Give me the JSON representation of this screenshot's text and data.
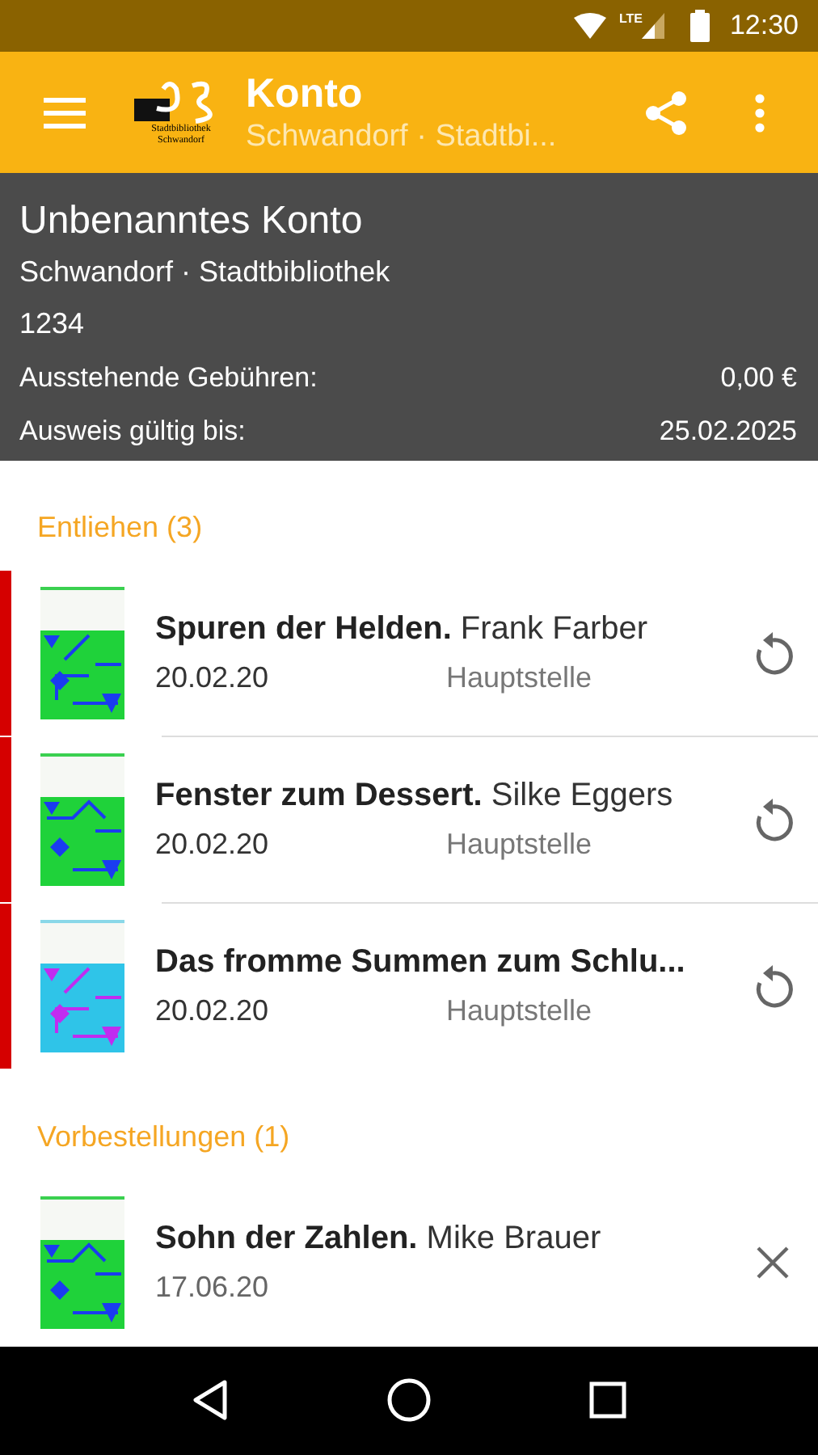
{
  "status_bar": {
    "network": "LTE",
    "time": "12:30"
  },
  "toolbar": {
    "logo_lines": [
      "Stadtbibliothek",
      "Schwandorf"
    ],
    "title": "Konto",
    "subtitle": "Schwandorf · Stadtbi..."
  },
  "account": {
    "name": "Unbenanntes Konto",
    "library": "Schwandorf · Stadtbibliothek",
    "number": "1234",
    "rows": [
      {
        "label": "Ausstehende Gebühren:",
        "value": "0,00 €"
      },
      {
        "label": "Ausweis gültig bis:",
        "value": "25.02.2025"
      }
    ]
  },
  "sections": [
    {
      "title": "Entliehen (3)",
      "kind": "renew",
      "items": [
        {
          "title": "Spuren der Helden.",
          "author": "Frank Farber",
          "date": "20.02.20",
          "branch": "Hauptstelle",
          "overdue": true
        },
        {
          "title": "Fenster zum Dessert.",
          "author": "Silke Eggers",
          "date": "20.02.20",
          "branch": "Hauptstelle",
          "overdue": true
        },
        {
          "title": "Das fromme Summen zum Schlu...",
          "date": "20.02.20",
          "branch": "Hauptstelle",
          "overdue": true
        }
      ]
    },
    {
      "title": "Vorbestellungen (1)",
      "kind": "cancel",
      "items": [
        {
          "title": "Sohn der Zahlen.",
          "author": "Mike Brauer",
          "date": "17.06.20",
          "overdue": false
        }
      ]
    }
  ]
}
